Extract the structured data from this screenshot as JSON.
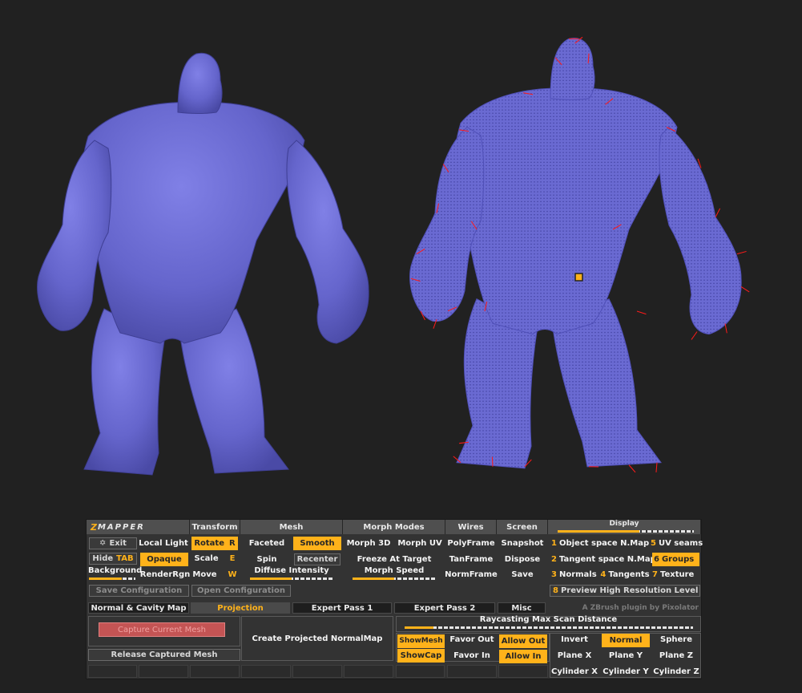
{
  "colors": {
    "accent": "#ffb21a",
    "body": "#6a6ad2",
    "wire": "#ff1a1a",
    "bg": "#212121"
  },
  "header": {
    "z": "Z",
    "title": "MAPPER",
    "transform": "Transform",
    "mesh": "Mesh",
    "morph_modes": "Morph Modes",
    "wires": "Wires",
    "screen": "Screen",
    "display": "Display"
  },
  "row1": {
    "exit": "Exit",
    "local_light": "Local Light",
    "rotate": "Rotate",
    "rotate_key": "R",
    "faceted": "Faceted",
    "smooth": "Smooth",
    "morph3d": "Morph 3D",
    "morphuv": "Morph UV",
    "polyframe": "PolyFrame",
    "snapshot": "Snapshot",
    "obj_num": "1",
    "obj": "Object space N.Map",
    "uv_num": "5",
    "uv": "UV seams"
  },
  "row2": {
    "hide": "Hide",
    "hide_key": "TAB",
    "opaque": "Opaque",
    "scale": "Scale",
    "scale_key": "E",
    "spin": "Spin",
    "recenter": "Recenter",
    "freeze": "Freeze At Target",
    "tanframe": "TanFrame",
    "dispose": "Dispose",
    "tan_num": "2",
    "tan": "Tangent space N.Map",
    "groups_num": "6",
    "groups": "Groups"
  },
  "row3": {
    "background": "Background",
    "renderrgn": "RenderRgn",
    "move": "Move",
    "move_key": "W",
    "diffuse": "Diffuse Intensity",
    "morph_speed": "Morph Speed",
    "normframe": "NormFrame",
    "save": "Save",
    "normals_num": "3",
    "normals": "Normals",
    "tangents_num": "4",
    "tangents": "Tangents",
    "texture_num": "7",
    "texture": "Texture"
  },
  "row4": {
    "save_config": "Save Configuration",
    "open_config": "Open Configuration",
    "preview_num": "8",
    "preview": "Preview High Resolution Level"
  },
  "tabs": {
    "normal_cavity": "Normal & Cavity Map",
    "projection": "Projection",
    "expert1": "Expert Pass 1",
    "expert2": "Expert Pass 2",
    "misc": "Misc",
    "credit": "A ZBrush plugin by Pixolator"
  },
  "projection": {
    "capture": "Capture Current Mesh",
    "release": "Release Captured Mesh",
    "create": "Create Projected NormalMap",
    "raycast": "Raycasting Max Scan Distance",
    "showmesh": "ShowMesh",
    "favor_out": "Favor Out",
    "allow_out": "Allow Out",
    "showcap": "ShowCap",
    "favor_in": "Favor In",
    "allow_in": "Allow In",
    "invert": "Invert",
    "normal": "Normal",
    "sphere": "Sphere",
    "plane_x": "Plane X",
    "plane_y": "Plane Y",
    "plane_z": "Plane Z",
    "cyl_x": "Cylinder X",
    "cyl_y": "Cylinder Y",
    "cyl_z": "Cylinder Z"
  },
  "sliders": {
    "display": 0.6,
    "background": 0.7,
    "diffuse": 0.5,
    "morph_speed": 0.5,
    "raycast": 0.1
  }
}
